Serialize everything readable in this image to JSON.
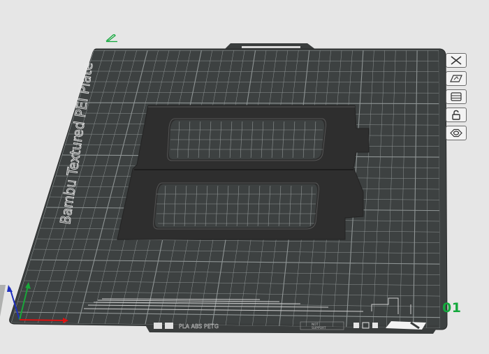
{
  "plate": {
    "name": "Bambu Textured PEI Plate",
    "number": "01",
    "filament_label": "PLA ABS PETG",
    "right_label_1": "NOT",
    "right_label_2": "SUPPORT"
  },
  "toolbar": {
    "items": [
      {
        "icon": "close-icon"
      },
      {
        "icon": "auto-orient-icon"
      },
      {
        "icon": "arrange-icon"
      },
      {
        "icon": "lock-icon"
      },
      {
        "icon": "plate-settings-icon"
      }
    ]
  },
  "colors": {
    "plate": "#3d4141",
    "grid": "#8f9595",
    "model": "#2e2e2e",
    "accent": "#13a83c",
    "background": "#e6e6e6"
  }
}
